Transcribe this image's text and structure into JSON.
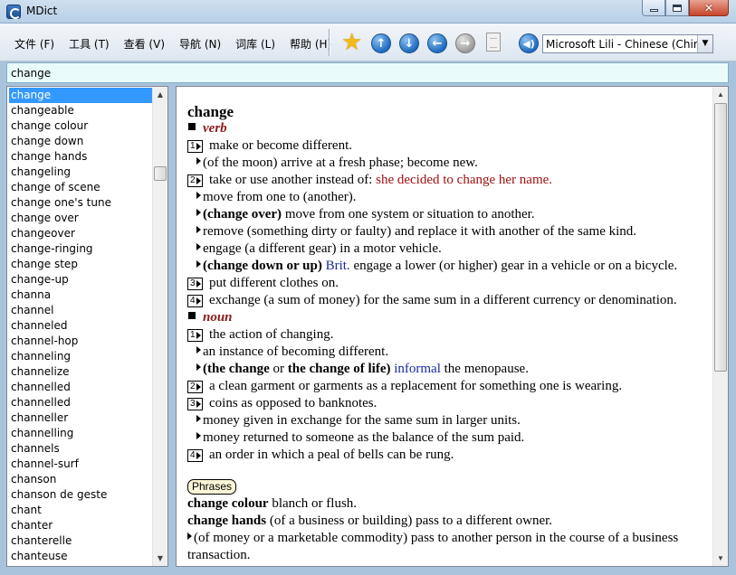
{
  "window": {
    "title": "MDict"
  },
  "menu": [
    "文件 (F)",
    "工具 (T)",
    "查看 (V)",
    "导航 (N)",
    "词库 (L)",
    "帮助 (H)"
  ],
  "voice": {
    "selected": "Microsoft Lili - Chinese (China)"
  },
  "search": {
    "value": "change"
  },
  "wordlist": {
    "selected_index": 0,
    "items": [
      "change",
      "changeable",
      "change colour",
      "change down",
      "change hands",
      "changeling",
      "change of scene",
      "change one's tune",
      "change over",
      "changeover",
      "change-ringing",
      "change step",
      "change-up",
      "channa",
      "channel",
      "channeled",
      "channel-hop",
      "channeling",
      "channelize",
      "channelled",
      "channelled",
      "channeller",
      "channelling",
      "channels",
      "channel-surf",
      "chanson",
      "chanson de geste",
      "chant",
      "chanter",
      "chanterelle",
      "chanteuse"
    ]
  },
  "entry": {
    "headword": "change",
    "verb_label": "verb",
    "noun_label": "noun",
    "phrases_label": "Phrases",
    "lines": [
      {
        "kind": "num",
        "n": "1",
        "text": "make or become different."
      },
      {
        "kind": "sub",
        "text": "(of the moon) arrive at a fresh phase; become new."
      },
      {
        "kind": "num",
        "n": "2",
        "text": "take or use another instead of: ",
        "example": "she decided to change her name."
      },
      {
        "kind": "sub",
        "text": "move from one to (another)."
      },
      {
        "kind": "sub",
        "bold": "(change over)",
        "text": " move from one system or situation to another."
      },
      {
        "kind": "sub",
        "text": "remove (something dirty or faulty) and replace it with another of the same kind."
      },
      {
        "kind": "sub",
        "text": "engage (a different gear) in a motor vehicle."
      },
      {
        "kind": "sub",
        "bold": "(change down or up)",
        "register": " Brit.",
        "text": " engage a lower (or higher) gear in a vehicle or on a bicycle."
      },
      {
        "kind": "num",
        "n": "3",
        "text": "put different clothes on."
      },
      {
        "kind": "num",
        "n": "4",
        "text": "exchange (a sum of money) for the same sum in a different currency or denomination."
      },
      {
        "kind": "num",
        "n": "1",
        "text": "the action of changing."
      },
      {
        "kind": "sub",
        "text": "an instance of becoming different."
      },
      {
        "kind": "sub",
        "bold": "(the change",
        "mid": " or ",
        "bold2": "the change of life)",
        "register": " informal",
        "text": " the menopause."
      },
      {
        "kind": "num",
        "n": "2",
        "text": "a clean garment or garments as a replacement for something one is wearing."
      },
      {
        "kind": "num",
        "n": "3",
        "text": "coins as opposed to banknotes."
      },
      {
        "kind": "sub",
        "text": "money given in exchange for the same sum in larger units."
      },
      {
        "kind": "sub",
        "text": "money returned to someone as the balance of the sum paid."
      },
      {
        "kind": "num",
        "n": "4",
        "text": "an order in which a peal of bells can be rung."
      }
    ],
    "phrases": [
      {
        "term": "change colour",
        "text": " blanch or flush."
      },
      {
        "term": "change hands",
        "text": " (of a business or building) pass to a different owner."
      }
    ],
    "phrase_sub": "(of money or a marketable commodity) pass to another person in the course of a business",
    "phrase_sub_cont": "transaction."
  },
  "colors": {
    "selection": "#3399ff",
    "example": "#a01010",
    "pos": "#8b1a1a",
    "register": "#1a2aa0",
    "search_bg": "#e9fbfb"
  }
}
